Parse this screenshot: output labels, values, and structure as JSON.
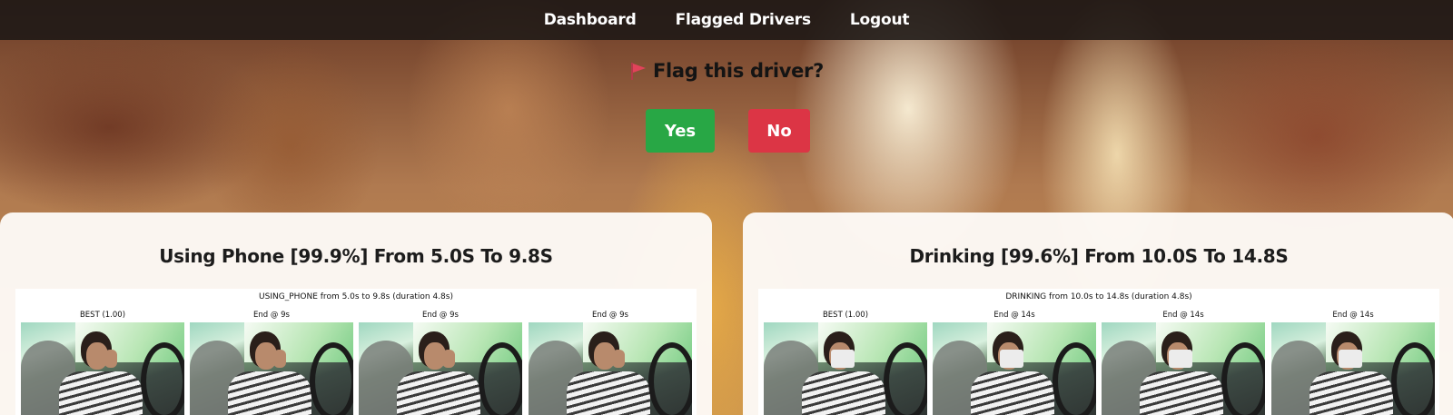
{
  "nav": {
    "dashboard": "Dashboard",
    "flagged_drivers": "Flagged Drivers",
    "logout": "Logout"
  },
  "flag_prompt": {
    "icon": "flag-icon",
    "text": "Flag this driver?",
    "yes_label": "Yes",
    "no_label": "No"
  },
  "colors": {
    "yes": "#28a745",
    "no": "#dc3545",
    "flag": "#e2435a",
    "nav_bg": "#1c1816"
  },
  "cards": [
    {
      "title": "Using Phone [99.9%] From 5.0S To 9.8S",
      "figure_title": "USING_PHONE from 5.0s to 9.8s (duration 4.8s)",
      "frames": [
        "BEST (1.00)",
        "End @ 9s",
        "End @ 9s",
        "End @ 9s"
      ]
    },
    {
      "title": "Drinking [99.6%] From 10.0S To 14.8S",
      "figure_title": "DRINKING from 10.0s to 14.8s (duration 4.8s)",
      "frames": [
        "BEST (1.00)",
        "End @ 14s",
        "End @ 14s",
        "End @ 14s"
      ]
    }
  ]
}
